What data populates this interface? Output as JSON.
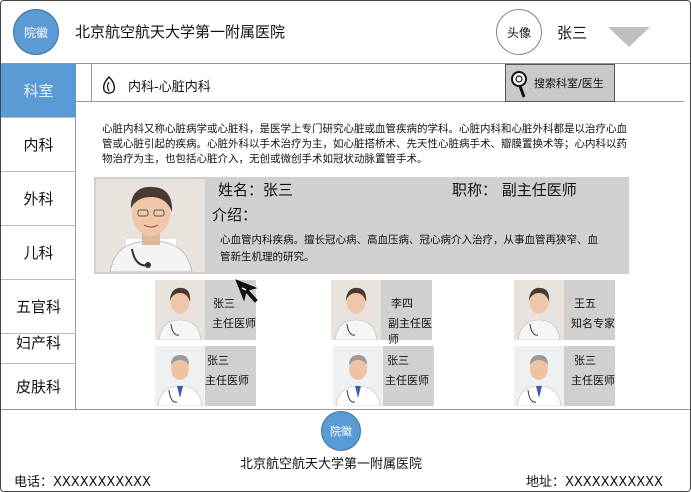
{
  "header": {
    "logo_label": "院徽",
    "hospital_name": "北京航空航天大学第一附属医院",
    "avatar_label": "头像",
    "user_name": "张三"
  },
  "sidebar": {
    "items": [
      {
        "label": "科室"
      },
      {
        "label": "内科"
      },
      {
        "label": "外科"
      },
      {
        "label": "儿科"
      },
      {
        "label": "五官科"
      },
      {
        "label": "妇产科"
      },
      {
        "label": "皮肤科"
      }
    ]
  },
  "department": {
    "title": "内科-心脏内科",
    "search_label": "搜索科室/医生",
    "description": "心脏内科又称心脏病学或心脏科，是医学上专门研究心脏或血管疾病的学科。心脏内科和心脏外科都是以治疗心血管或心脏引起的疾病。心脏外科以手术治疗为主，如心脏搭桥术、先天性心脏病手术、瓣膜置换术等；心内科以药物治疗为主，也包括心脏介入，无创或微创手术如冠状动脉置管手术。"
  },
  "featured": {
    "name": "姓名：张三",
    "title": "职称：  副主任医师",
    "intro_label": "介绍：",
    "intro": "心血管内科疾病。擅长冠心病、高血压病、冠心病介入治疗，从事血管再狭窄、血管新生机理的研究。"
  },
  "doctors": [
    {
      "name": "张三",
      "title": "主任医师"
    },
    {
      "name": "李四",
      "title": "副主任医师"
    },
    {
      "name": "王五",
      "title": "知名专家"
    },
    {
      "name": "张三",
      "title": "主任医师"
    },
    {
      "name": "张三",
      "title": "主任医师"
    },
    {
      "name": "张三",
      "title": "主任医师"
    }
  ],
  "footer": {
    "logo_label": "院徽",
    "hospital_name": "北京航空航天大学第一附属医院",
    "phone": "电话：XXXXXXXXXXX",
    "address": "地址：XXXXXXXXXXX"
  },
  "colors": {
    "accent": "#5b9bd5",
    "panel_gray": "#d0d0d0"
  }
}
